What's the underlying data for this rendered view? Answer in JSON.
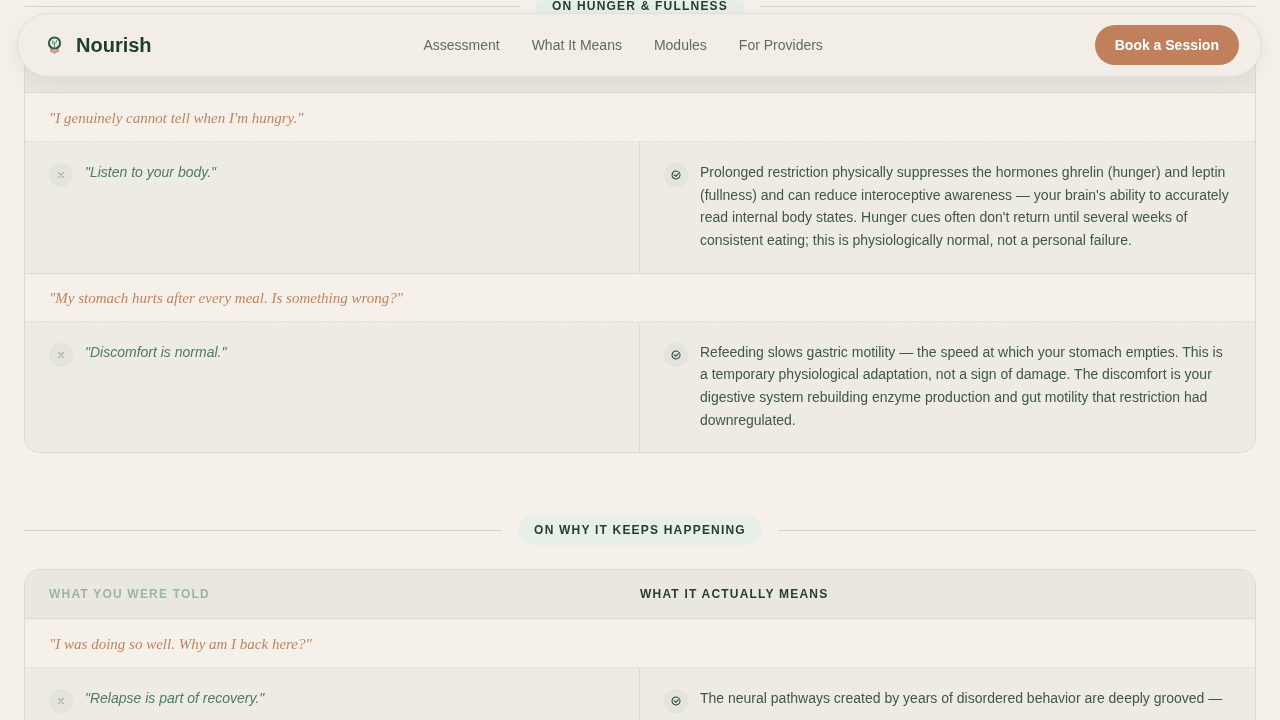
{
  "nav": {
    "brand": "Nourish",
    "links": [
      "Assessment",
      "What It Means",
      "Modules",
      "For Providers"
    ],
    "cta": "Book a Session"
  },
  "sections": [
    {
      "title": "ON HUNGER & FULLNESS",
      "rows": [
        {
          "question": "\"I genuinely cannot tell when I'm hungry.\"",
          "told": "\"Listen to your body.\"",
          "means": "Prolonged restriction physically suppresses the hormones ghrelin (hunger) and leptin (fullness) and can reduce interoceptive awareness — your brain's ability to accurately read internal body states. Hunger cues often don't return until several weeks of consistent eating; this is physiologically normal, not a personal failure."
        },
        {
          "question": "\"My stomach hurts after every meal. Is something wrong?\"",
          "told": "\"Discomfort is normal.\"",
          "means": "Refeeding slows gastric motility — the speed at which your stomach empties. This is a temporary physiological adaptation, not a sign of damage. The discomfort is your digestive system rebuilding enzyme production and gut motility that restriction had downregulated."
        }
      ]
    },
    {
      "title": "ON WHY IT KEEPS HAPPENING",
      "columns": [
        "WHAT YOU WERE TOLD",
        "WHAT IT ACTUALLY MEANS"
      ],
      "rows": [
        {
          "question": "\"I was doing so well. Why am I back here?\"",
          "told": "\"Relapse is part of recovery.\"",
          "means": "The neural pathways created by years of disordered behavior are deeply grooved —"
        }
      ]
    }
  ]
}
